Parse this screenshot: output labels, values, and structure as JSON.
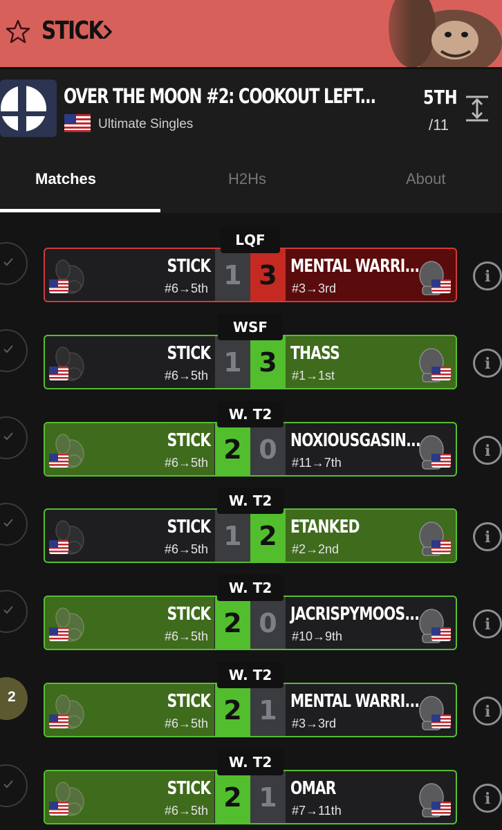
{
  "header": {
    "player_name": "STICK"
  },
  "tournament": {
    "name": "OVER THE MOON #2: COOKOUT LEFT...",
    "event": "Ultimate Singles",
    "placement": "5TH",
    "entrants": "/11"
  },
  "tabs": [
    {
      "label": "Matches",
      "active": true
    },
    {
      "label": "H2Hs",
      "active": false
    },
    {
      "label": "About",
      "active": false
    }
  ],
  "matches": [
    {
      "round": "LQF",
      "status": "check",
      "left_name": "STICK",
      "left_seed": "#6→5th",
      "left_score": "1",
      "right_score": "3",
      "right_name": "MENTAL WARRI...",
      "right_seed": "#3→3rd",
      "result": "loss-red"
    },
    {
      "round": "WSF",
      "status": "check",
      "left_name": "STICK",
      "left_seed": "#6→5th",
      "left_score": "1",
      "right_score": "3",
      "right_name": "THASS",
      "right_seed": "#1→1st",
      "result": "loss-green"
    },
    {
      "round": "W. T2",
      "status": "check",
      "left_name": "STICK",
      "left_seed": "#6→5th",
      "left_score": "2",
      "right_score": "0",
      "right_name": "NOXIOUSGASIN...",
      "right_seed": "#11→7th",
      "result": "win"
    },
    {
      "round": "W. T2",
      "status": "check",
      "left_name": "STICK",
      "left_seed": "#6→5th",
      "left_score": "1",
      "right_score": "2",
      "right_name": "ETANKED",
      "right_seed": "#2→2nd",
      "result": "loss-green"
    },
    {
      "round": "W. T2",
      "status": "check",
      "left_name": "STICK",
      "left_seed": "#6→5th",
      "left_score": "2",
      "right_score": "0",
      "right_name": "JACRISPYMOOS...",
      "right_seed": "#10→9th",
      "result": "win"
    },
    {
      "round": "W. T2",
      "status": "2",
      "left_name": "STICK",
      "left_seed": "#6→5th",
      "left_score": "2",
      "right_score": "1",
      "right_name": "MENTAL WARRI...",
      "right_seed": "#3→3rd",
      "result": "win"
    },
    {
      "round": "W. T2",
      "status": "check",
      "left_name": "STICK",
      "left_seed": "#6→5th",
      "left_score": "2",
      "right_score": "1",
      "right_name": "OMAR",
      "right_seed": "#7→11th",
      "result": "win"
    }
  ],
  "colors": {
    "header_bg": "#d8605a",
    "win_green": "#52be2e",
    "loss_red": "#c42a21"
  },
  "icons": [
    "star-icon",
    "chevron-right-icon",
    "expand-icon",
    "check-icon",
    "info-icon",
    "us-flag-icon"
  ]
}
